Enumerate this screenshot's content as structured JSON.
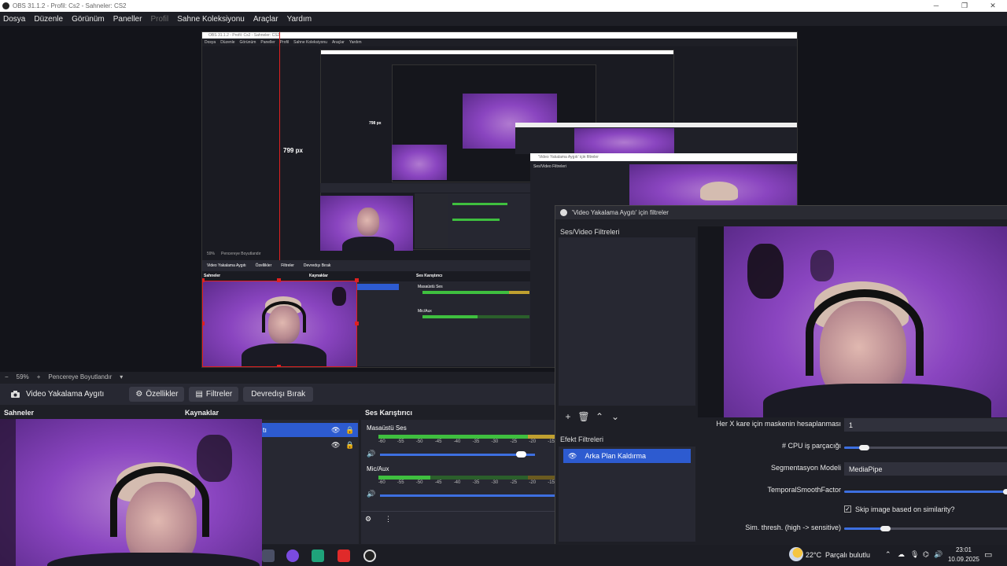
{
  "window": {
    "title": "OBS 31.1.2 - Profil: Cs2 - Sahneler: CS2",
    "controls": [
      "─",
      "❐",
      "✕"
    ]
  },
  "menu": [
    "Dosya",
    "Düzenle",
    "Görünüm",
    "Paneller",
    "Profil",
    "Sahne Koleksiyonu",
    "Araçlar",
    "Yardım"
  ],
  "preview": {
    "nested_labels": {
      "px1": "799 px",
      "px2": "798 px"
    },
    "mini_menu": [
      "Dosya",
      "Düzenle",
      "Görünüm",
      "Paneller",
      "Profil",
      "Sahne Koleksiyonu",
      "Araçlar",
      "Yardım"
    ],
    "mini_title": "OBS 31.1.2 - Profil: Cs2 - Sahneler: CS2",
    "mini_zoom": "59%",
    "mini_zoom_label": "Pencereye Boyutlandır",
    "mini_source": "Video Yakalama Aygıtı",
    "mini_props": "Özellikler",
    "mini_filters": "Filtreler",
    "mini_deactivate": "Devredışı Bırak",
    "mini_scenes": "Sahneler",
    "mini_sources": "Kaynaklar",
    "mini_mixer": "Ses Karıştırıcı",
    "mini_desktop": "Masaüstü Ses",
    "mini_mic": "Mic/Aux",
    "mini_filter_win": "'Video Yakalama Aygıtı' için filtreler",
    "mini_av_filters": "Ses/Video Filtreleri"
  },
  "zoombar": {
    "minus": "−",
    "zoom": "59%",
    "plus": "+",
    "fit": "Pencereye Boyutlandır",
    "dropdown": "▾"
  },
  "source_toolbar": {
    "source_name": "Video Yakalama Aygıtı",
    "properties": "Özellikler",
    "filters": "Filtreler",
    "deactivate": "Devredışı Bırak"
  },
  "docks": {
    "scenes": "Sahneler",
    "sources": "Kaynaklar",
    "sources_item_tail": "tı",
    "mixer": "Ses Karıştırıcı",
    "desktop_audio": "Masaüstü Ses",
    "mic": "Mic/Aux",
    "scale": [
      "-60",
      "-55",
      "-50",
      "-45",
      "-40",
      "-35",
      "-30",
      "-25",
      "-20",
      "-15"
    ],
    "desktop_volume": 0.88,
    "mic_volume": 0.0
  },
  "filters_window": {
    "title": "'Video Yakalama Aygıtı' için filtreler",
    "av_filters": "Ses/Video Filtreleri",
    "effect_filters": "Efekt Filtreleri",
    "effect_item": "Arka Plan Kaldırma",
    "props": {
      "mask_every_x_label": "Her X kare için maskenin hesaplanması",
      "mask_every_x_value": "1",
      "cpu_threads_label": "# CPU iş parçacığı",
      "cpu_threads_level": 0.12,
      "segmentation_label": "Segmentasyon Modeli",
      "segmentation_value": "MediaPipe",
      "temporal_label": "TemporalSmoothFactor",
      "temporal_level": 1.0,
      "skip_label": "Skip image based on similarity?",
      "skip_checked": true,
      "sim_label": "Sim. thresh. (high -> sensitive)",
      "sim_level": 0.25
    }
  },
  "taskbar": {
    "weather_temp": "22°C",
    "weather_text": "Parçalı bulutlu",
    "time": "23:01",
    "date": "10.09.2025",
    "chevron": "⌃"
  }
}
